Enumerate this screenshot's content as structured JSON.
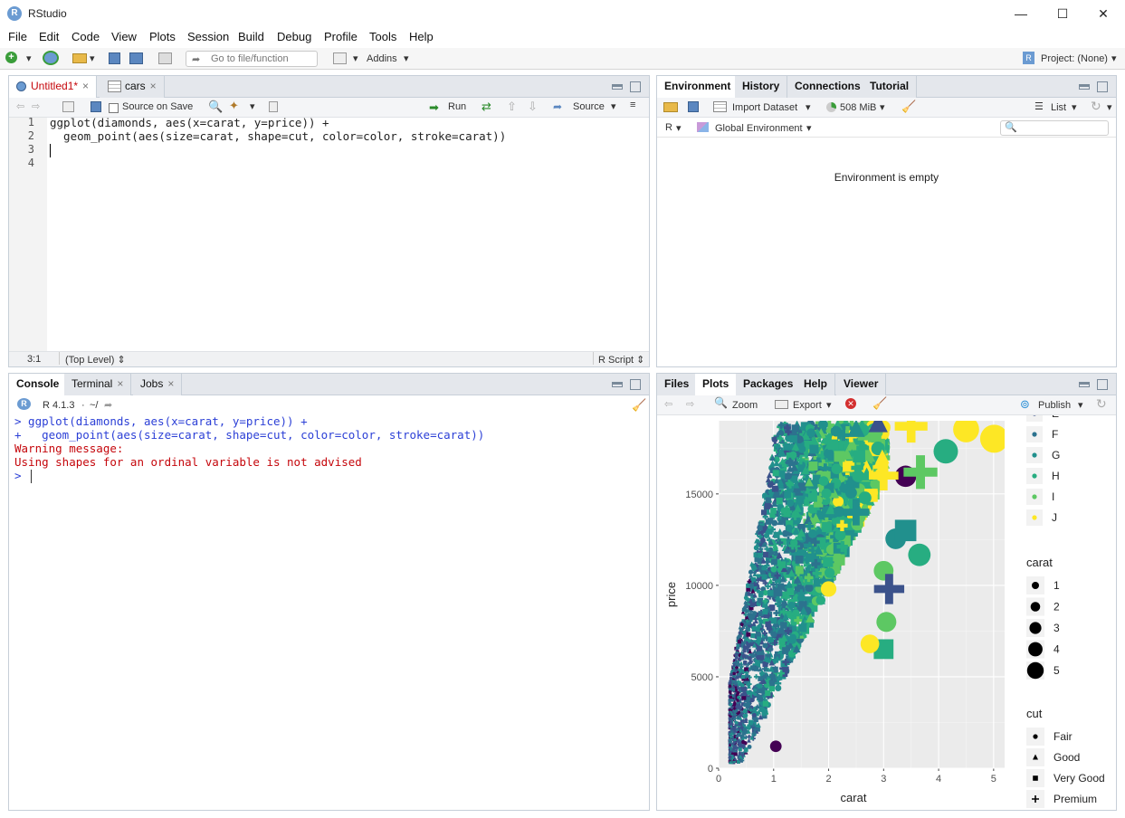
{
  "window": {
    "title": "RStudio"
  },
  "menu": [
    "File",
    "Edit",
    "Code",
    "View",
    "Plots",
    "Session",
    "Build",
    "Debug",
    "Profile",
    "Tools",
    "Help"
  ],
  "toolbar": {
    "goto_placeholder": "Go to file/function",
    "addins": "Addins",
    "project": "Project: (None)"
  },
  "editor": {
    "tabs": [
      "Untitled1*",
      "cars"
    ],
    "source_on_save": "Source on Save",
    "run": "Run",
    "source": "Source",
    "line_numbers": [
      "1",
      "2",
      "3",
      "4"
    ],
    "lines": [
      "ggplot(diamonds, aes(x=carat, y=price)) +",
      "  geom_point(aes(size=carat, shape=cut, color=color, stroke=carat))",
      "",
      ""
    ],
    "status_pos": "3:1",
    "status_scope": "(Top Level)",
    "status_type": "R Script"
  },
  "console": {
    "tabs": [
      "Console",
      "Terminal",
      "Jobs"
    ],
    "version": "R 4.1.3",
    "path": "~/",
    "lines": [
      {
        "text": "> ggplot(diamonds, aes(x=carat, y=price)) +",
        "color": "#2b3fd6"
      },
      {
        "text": "+   geom_point(aes(size=carat, shape=cut, color=color, stroke=carat))",
        "color": "#2b3fd6"
      },
      {
        "text": "Warning message:",
        "color": "#c5060b"
      },
      {
        "text": "Using shapes for an ordinal variable is not advised",
        "color": "#c5060b"
      },
      {
        "text": "> ",
        "color": "#2b3fd6"
      }
    ]
  },
  "environment": {
    "tabs": [
      "Environment",
      "History",
      "Connections",
      "Tutorial"
    ],
    "import": "Import Dataset",
    "memory": "508 MiB",
    "view": "List",
    "lang": "R",
    "scope": "Global Environment",
    "empty": "Environment is empty"
  },
  "files": {
    "tabs": [
      "Files",
      "Plots",
      "Packages",
      "Help",
      "Viewer"
    ],
    "zoom": "Zoom",
    "export": "Export",
    "publish": "Publish"
  },
  "chart_data": {
    "type": "scatter",
    "xlabel": "carat",
    "ylabel": "price",
    "xlim": [
      0,
      5.2
    ],
    "ylim": [
      0,
      19000
    ],
    "xticks": [
      "0",
      "1",
      "2",
      "3",
      "4",
      "5"
    ],
    "yticks": [
      "0",
      "5000",
      "10000",
      "15000"
    ],
    "ytick_values": [
      0,
      5000,
      10000,
      15000
    ],
    "xtick_values": [
      0,
      1,
      2,
      3,
      4,
      5
    ],
    "legends": {
      "color": {
        "title": "",
        "items": [
          "E",
          "F",
          "G",
          "H",
          "I",
          "J"
        ],
        "colors": [
          "#3b528b",
          "#2c728e",
          "#21908d",
          "#27ad81",
          "#5dc863",
          "#fde725"
        ]
      },
      "carat": {
        "title": "carat",
        "items": [
          "1",
          "2",
          "3",
          "4",
          "5"
        ]
      },
      "cut": {
        "title": "cut",
        "items": [
          "Fair",
          "Good",
          "Very Good",
          "Premium"
        ]
      }
    },
    "highlight_points": [
      {
        "x": 4.5,
        "y": 18531,
        "color": "#fde725",
        "shape": "circle"
      },
      {
        "x": 5.01,
        "y": 18018,
        "color": "#fde725",
        "shape": "circle"
      },
      {
        "x": 4.13,
        "y": 17329,
        "color": "#27ad81",
        "shape": "circle"
      },
      {
        "x": 3.4,
        "y": 15964,
        "color": "#440154",
        "shape": "circle"
      },
      {
        "x": 3.67,
        "y": 16193,
        "color": "#5dc863",
        "shape": "cross"
      },
      {
        "x": 3.0,
        "y": 16000,
        "color": "#fde725",
        "shape": "cross"
      },
      {
        "x": 3.65,
        "y": 11668,
        "color": "#27ad81",
        "shape": "circle"
      },
      {
        "x": 3.22,
        "y": 12545,
        "color": "#21908d",
        "shape": "circle"
      },
      {
        "x": 3.0,
        "y": 6512,
        "color": "#27ad81",
        "shape": "square"
      },
      {
        "x": 2.75,
        "y": 6800,
        "color": "#fde725",
        "shape": "circle"
      },
      {
        "x": 3.05,
        "y": 8000,
        "color": "#5dc863",
        "shape": "circle"
      },
      {
        "x": 3.4,
        "y": 13000,
        "color": "#21908d",
        "shape": "square"
      },
      {
        "x": 2.5,
        "y": 18500,
        "color": "#21908d",
        "shape": "triangle"
      },
      {
        "x": 3.5,
        "y": 18700,
        "color": "#fde725",
        "shape": "cross"
      },
      {
        "x": 2.9,
        "y": 18800,
        "color": "#3b528b",
        "shape": "triangle"
      },
      {
        "x": 1.04,
        "y": 1200,
        "color": "#440154",
        "shape": "circle"
      },
      {
        "x": 3.0,
        "y": 10800,
        "color": "#5dc863",
        "shape": "circle"
      },
      {
        "x": 2.0,
        "y": 9800,
        "color": "#fde725",
        "shape": "circle"
      },
      {
        "x": 2.5,
        "y": 14000,
        "color": "#21908d",
        "shape": "cross"
      },
      {
        "x": 3.1,
        "y": 9800,
        "color": "#3b528b",
        "shape": "cross"
      }
    ]
  },
  "colors": {
    "accent": "#4a90d9",
    "pane_border": "#c7cfd8",
    "console_blue": "#2b3fd6",
    "console_red": "#c5060b"
  }
}
